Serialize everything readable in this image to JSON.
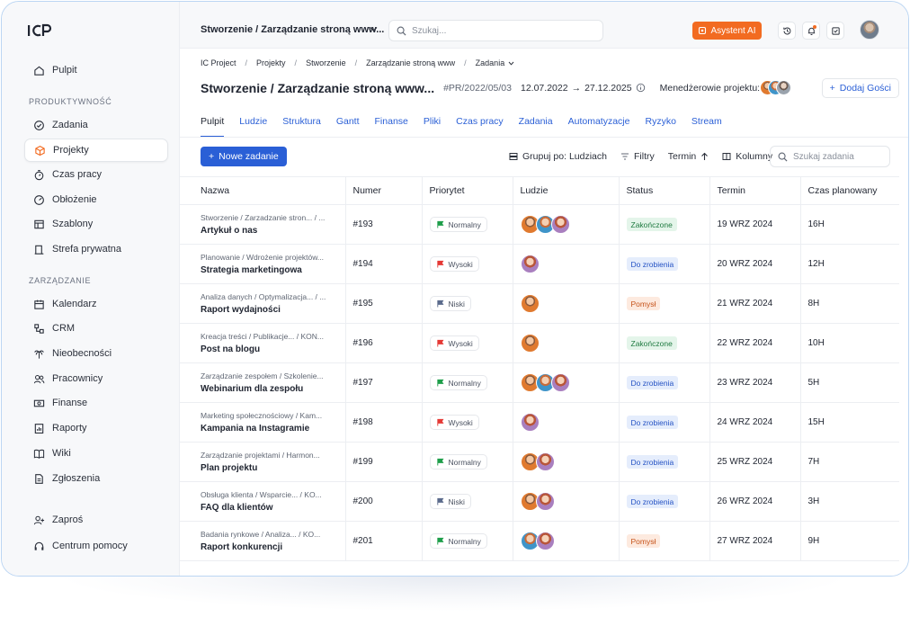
{
  "sidebar": {
    "logo": "ICP",
    "items_top": [
      {
        "label": "Pulpit",
        "icon": "home-icon"
      }
    ],
    "section1": "PRODUKTYWNOŚĆ",
    "items_prod": [
      {
        "label": "Zadania",
        "icon": "check-circle-icon"
      },
      {
        "label": "Projekty",
        "icon": "cube-icon",
        "active": true
      },
      {
        "label": "Czas pracy",
        "icon": "stopwatch-icon"
      },
      {
        "label": "Obłożenie",
        "icon": "gauge-icon"
      },
      {
        "label": "Szablony",
        "icon": "layout-icon"
      },
      {
        "label": "Strefa prywatna",
        "icon": "door-icon"
      }
    ],
    "section2": "ZARZĄDZANIE",
    "items_mgmt": [
      {
        "label": "Kalendarz",
        "icon": "calendar-icon"
      },
      {
        "label": "CRM",
        "icon": "crm-icon"
      },
      {
        "label": "Nieobecności",
        "icon": "palm-icon"
      },
      {
        "label": "Pracownicy",
        "icon": "users-icon"
      },
      {
        "label": "Finanse",
        "icon": "money-icon"
      },
      {
        "label": "Raporty",
        "icon": "report-icon"
      },
      {
        "label": "Wiki",
        "icon": "book-icon"
      },
      {
        "label": "Zgłoszenia",
        "icon": "document-icon"
      }
    ],
    "items_bottom": [
      {
        "label": "Zaproś",
        "icon": "user-plus-icon"
      },
      {
        "label": "Centrum pomocy",
        "icon": "headset-icon"
      }
    ]
  },
  "topbar": {
    "project_select": "Stworzenie / Zarządzanie stroną www...",
    "search_placeholder": "Szukaj...",
    "ai_button": "Asystent AI"
  },
  "breadcrumb": [
    "IC Project",
    "Projekty",
    "Stworzenie",
    "Zarządzanie stroną www",
    "Zadania"
  ],
  "header": {
    "title": "Stworzenie / Zarządzanie stroną www...",
    "code": "#PR/2022/05/03",
    "date_start": "12.07.2022",
    "date_end": "27.12.2025",
    "managers_label": "Menedżerowie projektu:",
    "add_guests": "Dodaj Gości"
  },
  "tabs": [
    "Pulpit",
    "Ludzie",
    "Struktura",
    "Gantt",
    "Finanse",
    "Pliki",
    "Czas pracy",
    "Zadania",
    "Automatyzacje",
    "Ryzyko",
    "Stream"
  ],
  "toolbar": {
    "new_task": "Nowe zadanie",
    "group_by": "Grupuj po: Ludziach",
    "filters": "Filtry",
    "term": "Termin",
    "columns": "Kolumny",
    "search_placeholder": "Szukaj zadania"
  },
  "table": {
    "columns": [
      "Nazwa",
      "Numer",
      "Priorytet",
      "Ludzie",
      "Status",
      "Termin",
      "Czas planowany"
    ],
    "rows": [
      {
        "path": "Stworzenie / Zarzadzanie stron... / ...",
        "name": "Artykuł o nas",
        "number": "#193",
        "priority": "Normalny",
        "prio_color": "#1e9e4a",
        "people": [
          "a1",
          "a2",
          "a3"
        ],
        "status": "Zakończone",
        "status_type": "done",
        "term": "19 WRZ 2024",
        "time": "16H"
      },
      {
        "path": "Planowanie / Wdrożenie projektów...",
        "name": "Strategia marketingowa",
        "number": "#194",
        "priority": "Wysoki",
        "prio_color": "#e53935",
        "people": [
          "a3"
        ],
        "status": "Do zrobienia",
        "status_type": "todo",
        "term": "20 WRZ 2024",
        "time": "12H"
      },
      {
        "path": "Analiza danych / Optymalizacja... / ...",
        "name": "Raport wydajności",
        "number": "#195",
        "priority": "Niski",
        "prio_color": "#5b6b8c",
        "people": [
          "a1"
        ],
        "status": "Pomysł",
        "status_type": "idea",
        "term": "21 WRZ 2024",
        "time": "8H"
      },
      {
        "path": "Kreacja treści / Publikacje... / KON...",
        "name": "Post na blogu",
        "number": "#196",
        "priority": "Wysoki",
        "prio_color": "#e53935",
        "people": [
          "a1"
        ],
        "status": "Zakończone",
        "status_type": "done",
        "term": "22 WRZ 2024",
        "time": "10H"
      },
      {
        "path": "Zarządzanie zespołem / Szkolenie...",
        "name": "Webinarium dla zespołu",
        "number": "#197",
        "priority": "Normalny",
        "prio_color": "#1e9e4a",
        "people": [
          "a1",
          "a2",
          "a3"
        ],
        "status": "Do zrobienia",
        "status_type": "todo",
        "term": "23 WRZ 2024",
        "time": "5H"
      },
      {
        "path": "Marketing społecznościowy / Kam...",
        "name": "Kampania na Instagramie",
        "number": "#198",
        "priority": "Wysoki",
        "prio_color": "#e53935",
        "people": [
          "a3"
        ],
        "status": "Do zrobienia",
        "status_type": "todo",
        "term": "24 WRZ 2024",
        "time": "15H"
      },
      {
        "path": "Zarządzanie projektami / Harmon...",
        "name": "Plan projektu",
        "number": "#199",
        "priority": "Normalny",
        "prio_color": "#1e9e4a",
        "people": [
          "a1",
          "a3"
        ],
        "status": "Do zrobienia",
        "status_type": "todo",
        "term": "25 WRZ 2024",
        "time": "7H"
      },
      {
        "path": "Obsługa klienta / Wsparcie... / KO...",
        "name": "FAQ dla klientów",
        "number": "#200",
        "priority": "Niski",
        "prio_color": "#5b6b8c",
        "people": [
          "a1",
          "a3"
        ],
        "status": "Do zrobienia",
        "status_type": "todo",
        "term": "26 WRZ 2024",
        "time": "3H"
      },
      {
        "path": "Badania rynkowe / Analiza... / KO...",
        "name": "Raport konkurencji",
        "number": "#201",
        "priority": "Normalny",
        "prio_color": "#1e9e4a",
        "people": [
          "a2",
          "a3"
        ],
        "status": "Pomysł",
        "status_type": "idea",
        "term": "27 WRZ 2024",
        "time": "9H"
      }
    ]
  }
}
